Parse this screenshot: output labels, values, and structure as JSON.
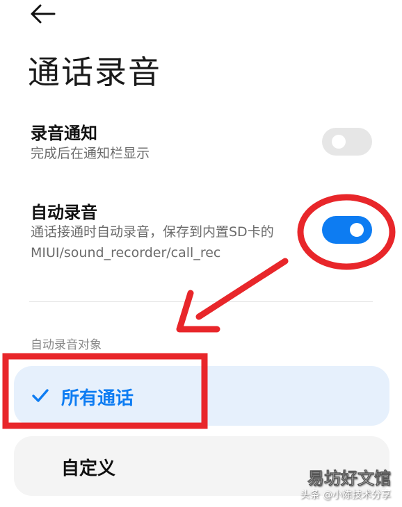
{
  "header": {
    "back_icon": "arrow-left-icon",
    "title": "通话录音"
  },
  "settings": [
    {
      "title": "录音通知",
      "description": [
        "完成后在通知栏显示"
      ],
      "toggle_on": false
    },
    {
      "title": "自动录音",
      "description": [
        "通话接通时自动录音，保存到内置SD卡的",
        "MIUI/sound_recorder/call_rec"
      ],
      "toggle_on": true
    }
  ],
  "section": {
    "label": "自动录音对象",
    "options": [
      {
        "label": "所有通话",
        "selected": true,
        "icon": "check-icon"
      },
      {
        "label": "自定义",
        "selected": false
      }
    ]
  },
  "watermark": {
    "main": "易坊好文馆",
    "sub": "头条 @小陈技术分享"
  },
  "colors": {
    "accent": "#0d7cf2",
    "toggle_off": "#e6e6e6",
    "selected_bg": "#e6f0fc",
    "annotation": "#e8262a"
  }
}
